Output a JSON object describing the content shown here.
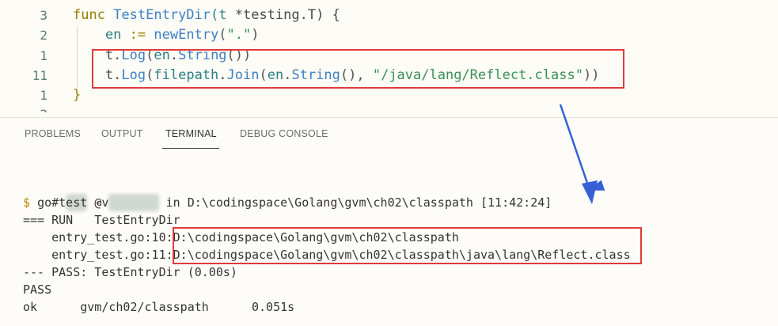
{
  "editor": {
    "lines": [
      {
        "number": "3",
        "tokens": [
          {
            "t": "func ",
            "c": "kw"
          },
          {
            "t": "TestEntryDir",
            "c": "fn"
          },
          {
            "t": "(t ",
            "c": "id"
          },
          {
            "t": "*testing.T) {",
            "c": "plain"
          }
        ]
      },
      {
        "number": "2",
        "tokens": [
          {
            "t": "    en ",
            "c": "id"
          },
          {
            "t": ":= ",
            "c": "kw"
          },
          {
            "t": "newEntry",
            "c": "fn"
          },
          {
            "t": "(",
            "c": "punct"
          },
          {
            "t": "\".\"",
            "c": "str"
          },
          {
            "t": ")",
            "c": "punct"
          }
        ]
      },
      {
        "number": "1",
        "tokens": [
          {
            "t": "    t.",
            "c": "plain"
          },
          {
            "t": "Log",
            "c": "fn"
          },
          {
            "t": "(",
            "c": "punct"
          },
          {
            "t": "en",
            "c": "id"
          },
          {
            "t": ".",
            "c": "plain"
          },
          {
            "t": "String",
            "c": "fn"
          },
          {
            "t": "())",
            "c": "punct"
          }
        ]
      },
      {
        "number": "11",
        "tokens": [
          {
            "t": "    t.",
            "c": "plain"
          },
          {
            "t": "Log",
            "c": "fn"
          },
          {
            "t": "(",
            "c": "punct"
          },
          {
            "t": "filepath",
            "c": "id"
          },
          {
            "t": ".",
            "c": "plain"
          },
          {
            "t": "Join",
            "c": "fn"
          },
          {
            "t": "(",
            "c": "punct"
          },
          {
            "t": "en",
            "c": "id"
          },
          {
            "t": ".",
            "c": "plain"
          },
          {
            "t": "String",
            "c": "fn"
          },
          {
            "t": "(), ",
            "c": "punct"
          },
          {
            "t": "\"/java/lang/Reflect.class\"",
            "c": "str"
          },
          {
            "t": "))",
            "c": "punct"
          }
        ]
      },
      {
        "number": "1",
        "tokens": [
          {
            "t": "}",
            "c": "kw"
          }
        ]
      },
      {
        "number": "2",
        "tokens": []
      }
    ]
  },
  "panel": {
    "tabs": [
      "PROBLEMS",
      "OUTPUT",
      "TERMINAL",
      "DEBUG CONSOLE"
    ],
    "active_tab": "TERMINAL"
  },
  "terminal": {
    "prompt_prefix": "#",
    "prompt_at": "@",
    "prompt_in": "in D:\\codingspace\\Golang\\gvm\\ch02\\classpath [11:42:24]",
    "dollar": "$",
    "command": "go test -v",
    "run_line": "=== RUN   TestEntryDir",
    "log1_file": "    entry_test.go:10:",
    "log1_value": "D:\\codingspace\\Golang\\gvm\\ch02\\classpath",
    "log2_file": "    entry_test.go:11:",
    "log2_value": "D:\\codingspace\\Golang\\gvm\\ch02\\classpath\\java\\lang\\Reflect.class",
    "pass_line": "--- PASS: TestEntryDir (0.00s)",
    "pass": "PASS",
    "ok_line": "ok      gvm/ch02/classpath      0.051s"
  },
  "colors": {
    "highlight_box": "#e03b3b",
    "arrow": "#3560d6"
  }
}
